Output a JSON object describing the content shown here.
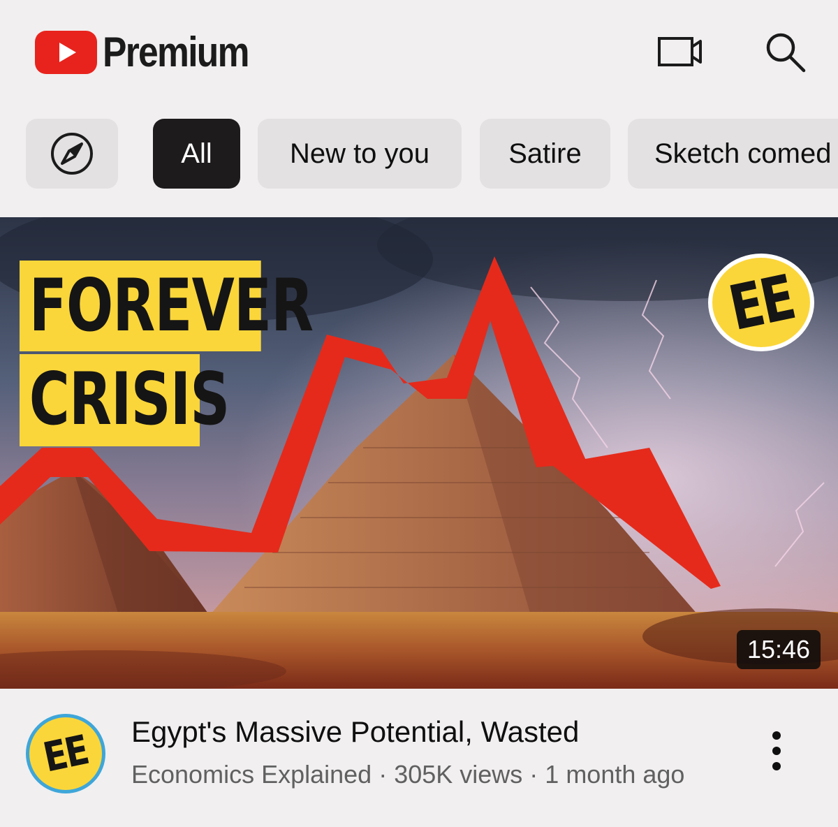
{
  "header": {
    "brand": "Premium",
    "brand_color": "#e8231d",
    "icons": [
      "youtube-logo-icon",
      "cast-icon",
      "search-icon"
    ]
  },
  "chips": {
    "explore_icon": "compass-icon",
    "items": [
      {
        "label": "All",
        "selected": true
      },
      {
        "label": "New to you",
        "selected": false
      },
      {
        "label": "Satire",
        "selected": false
      },
      {
        "label": "Sketch comed",
        "selected": false
      }
    ]
  },
  "video": {
    "thumbnail": {
      "headline_line1": "FOREVER",
      "headline_line2": "CRISIS",
      "badge": "EE",
      "duration": "15:46"
    },
    "channel_avatar": "EE",
    "title": "Egypt's Massive Potential, Wasted",
    "channel": "Economics Explained",
    "views": "305K views",
    "age": "1 month ago",
    "separator": " · ",
    "menu_icon": "more-vertical-icon"
  }
}
